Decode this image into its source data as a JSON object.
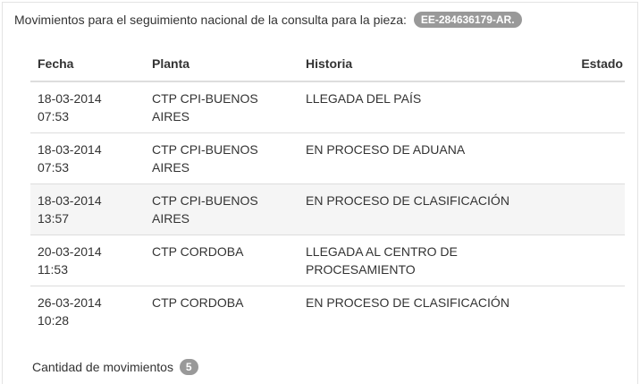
{
  "heading": {
    "text": "Movimientos para el seguimiento nacional de la consulta para la pieza:",
    "piece_id": "EE-284636179-AR."
  },
  "table": {
    "columns": [
      "Fecha",
      "Planta",
      "Historia",
      "Estado"
    ],
    "rows": [
      {
        "fecha_date": "18-03-2014",
        "fecha_time": "07:53",
        "planta_1": "CTP CPI-BUENOS",
        "planta_2": "AIRES",
        "historia_1": "LLEGADA DEL PAÍS",
        "historia_2": "",
        "estado": "",
        "highlight": false
      },
      {
        "fecha_date": "18-03-2014",
        "fecha_time": "07:53",
        "planta_1": "CTP CPI-BUENOS",
        "planta_2": "AIRES",
        "historia_1": "EN PROCESO DE ADUANA",
        "historia_2": "",
        "estado": "",
        "highlight": false
      },
      {
        "fecha_date": "18-03-2014",
        "fecha_time": "13:57",
        "planta_1": "CTP CPI-BUENOS",
        "planta_2": "AIRES",
        "historia_1": "EN PROCESO DE CLASIFICACIÓN",
        "historia_2": "",
        "estado": "",
        "highlight": true
      },
      {
        "fecha_date": "20-03-2014",
        "fecha_time": "11:53",
        "planta_1": "CTP CORDOBA",
        "planta_2": "",
        "historia_1": "LLEGADA AL CENTRO DE",
        "historia_2": "PROCESAMIENTO",
        "estado": "",
        "highlight": false
      },
      {
        "fecha_date": "26-03-2014",
        "fecha_time": "10:28",
        "planta_1": "CTP CORDOBA",
        "planta_2": "",
        "historia_1": "EN PROCESO DE CLASIFICACIÓN",
        "historia_2": "",
        "estado": "",
        "highlight": false
      }
    ]
  },
  "footer": {
    "label": "Cantidad de movimientos",
    "count": "5"
  },
  "colors": {
    "badge": "#999999",
    "highlight_row": "#f5f5f5",
    "border": "#dddddd",
    "text": "#333333"
  }
}
